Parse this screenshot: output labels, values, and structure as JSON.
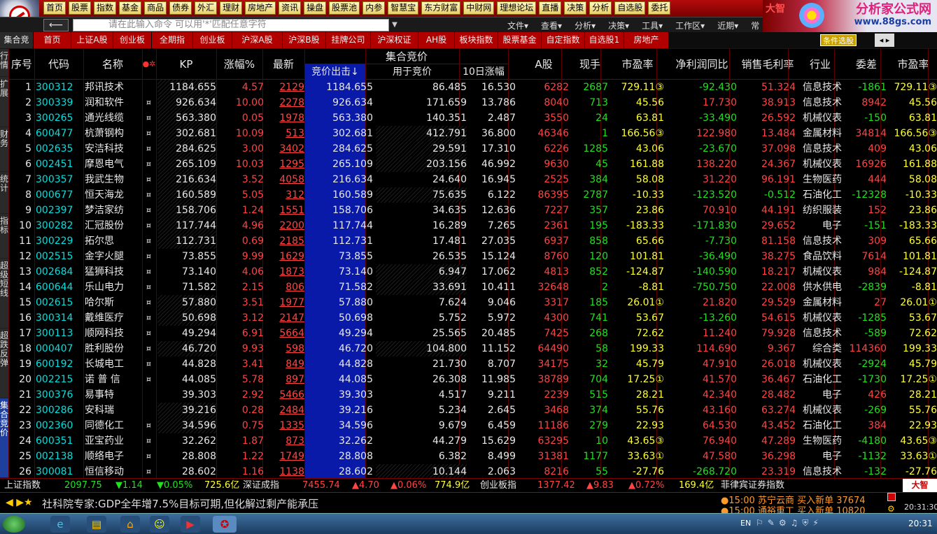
{
  "app": {
    "menu": [
      "首页",
      "股票",
      "指数",
      "基金",
      "商品",
      "债券",
      "外汇",
      "理财",
      "房地产",
      "资讯",
      "操盘",
      "股票池",
      "内参",
      "智慧宝",
      "东方财富",
      "中财网",
      "理想论坛",
      "直播",
      "决策",
      "分析",
      "自选股",
      "委托"
    ],
    "brand_left": "大智",
    "brand_title": "分析家公式网",
    "brand_url": "www.88gs.com"
  },
  "cmdbar": {
    "back": "⟵",
    "placeholder": "请在此输入命令    可以用'*'匹配任意字符"
  },
  "rmenu": [
    "文件▾",
    "查看▾",
    "分析▾",
    "决策▾",
    "工具▾",
    "工作区▾",
    "近期▾",
    "常"
  ],
  "tabs": [
    "集合竞价",
    "首页",
    "上证A股",
    "创业板",
    "全期指",
    "创业板",
    "沪深A股",
    "沪深B股",
    "挂牌公司",
    "沪深权证",
    "AH股",
    "板块指数",
    "股票基金",
    "自定指数",
    "自选股1",
    "房地产"
  ],
  "tab_search": "条件选股",
  "tab_arrows": "◂ ▸",
  "lefttabs": [
    "行情",
    "扩展",
    "财务",
    "统计",
    "指标",
    "超级短线",
    "超跌反弹",
    "集合竞价"
  ],
  "headers": {
    "seq": "序号",
    "code": "代码",
    "name": "名称",
    "dots": "●✲",
    "kp": "KP",
    "chg": "涨幅%",
    "last": "最新",
    "group": "集合竞价",
    "bid": "竞价出击↓",
    "used": "用于竞价",
    "d10": "10日涨幅",
    "ashare": "A股",
    "hand": "现手",
    "pe": "市盈率",
    "np": "净利润同比",
    "gm": "销售毛利率",
    "ind": "行业",
    "wc": "委差",
    "pe2": "市盈率"
  },
  "rows": [
    [
      "1",
      "300312",
      "邦讯技术",
      "",
      "1184.655",
      "4.57",
      "2129",
      "1184.655",
      "86.485",
      "16.530",
      "6282",
      "2687",
      "729.11③",
      "-92.430",
      "51.324",
      "信息技术",
      "-1861",
      "729.11③"
    ],
    [
      "2",
      "300339",
      "润和软件",
      "¤",
      "926.634",
      "10.00",
      "2278",
      "926.634",
      "171.659",
      "13.786",
      "8040",
      "713",
      "45.56",
      "17.730",
      "38.913",
      "信息技术",
      "8942",
      "45.56"
    ],
    [
      "3",
      "300265",
      "通光线缆",
      "¤",
      "563.380",
      "0.05",
      "1978",
      "563.380",
      "140.351",
      "2.487",
      "3550",
      "24",
      "63.81",
      "-33.490",
      "26.592",
      "机械仪表",
      "-150",
      "63.81"
    ],
    [
      "4",
      "600477",
      "杭萧钢构",
      "¤",
      "302.681",
      "10.09",
      "513",
      "302.681",
      "412.791",
      "36.800",
      "46346",
      "1",
      "166.56③",
      "122.980",
      "13.484",
      "金属材料",
      "34814",
      "166.56③"
    ],
    [
      "5",
      "002635",
      "安洁科技",
      "¤",
      "284.625",
      "3.00",
      "3402",
      "284.625",
      "29.591",
      "17.310",
      "6226",
      "1285",
      "43.06",
      "-23.670",
      "37.098",
      "信息技术",
      "409",
      "43.06"
    ],
    [
      "6",
      "002451",
      "摩恩电气",
      "¤",
      "265.109",
      "10.03",
      "1295",
      "265.109",
      "203.156",
      "46.992",
      "9630",
      "45",
      "161.88",
      "138.220",
      "24.367",
      "机械仪表",
      "16926",
      "161.88"
    ],
    [
      "7",
      "300357",
      "我武生物",
      "¤",
      "216.634",
      "3.52",
      "4058",
      "216.634",
      "24.640",
      "16.945",
      "2525",
      "384",
      "58.08",
      "31.220",
      "96.191",
      "生物医药",
      "444",
      "58.08"
    ],
    [
      "8",
      "000677",
      "恒天海龙",
      "¤",
      "160.589",
      "5.05",
      "312",
      "160.589",
      "75.635",
      "6.122",
      "86395",
      "2787",
      "-10.33",
      "-123.520",
      "-0.512",
      "石油化工",
      "-12328",
      "-10.33"
    ],
    [
      "9",
      "002397",
      "梦洁家纺",
      "¤",
      "158.706",
      "1.24",
      "1551",
      "158.706",
      "34.635",
      "12.636",
      "7227",
      "357",
      "23.86",
      "70.910",
      "44.191",
      "纺织服装",
      "152",
      "23.86"
    ],
    [
      "10",
      "300282",
      "汇冠股份",
      "¤",
      "117.744",
      "4.96",
      "2200",
      "117.744",
      "16.289",
      "7.265",
      "2361",
      "195",
      "-183.33",
      "-171.830",
      "29.652",
      "电子",
      "-151",
      "-183.33"
    ],
    [
      "11",
      "300229",
      "拓尔思",
      "¤",
      "112.731",
      "0.69",
      "2185",
      "112.731",
      "17.481",
      "27.035",
      "6937",
      "858",
      "65.66",
      "-7.730",
      "81.158",
      "信息技术",
      "309",
      "65.66"
    ],
    [
      "12",
      "002515",
      "金字火腿",
      "¤",
      "73.855",
      "9.99",
      "1629",
      "73.855",
      "26.535",
      "15.124",
      "8760",
      "120",
      "101.81",
      "-36.490",
      "38.275",
      "食品饮料",
      "7614",
      "101.81"
    ],
    [
      "13",
      "002684",
      "猛狮科技",
      "¤",
      "73.140",
      "4.06",
      "1873",
      "73.140",
      "6.947",
      "17.062",
      "4813",
      "852",
      "-124.87",
      "-140.590",
      "18.217",
      "机械仪表",
      "984",
      "-124.87"
    ],
    [
      "14",
      "600644",
      "乐山电力",
      "¤",
      "71.582",
      "2.15",
      "806",
      "71.582",
      "33.691",
      "10.411",
      "32648",
      "2",
      "-8.81",
      "-750.750",
      "22.008",
      "供水供电",
      "-2839",
      "-8.81"
    ],
    [
      "15",
      "002615",
      "哈尔斯",
      "¤",
      "57.880",
      "3.51",
      "1977",
      "57.880",
      "7.624",
      "9.046",
      "3317",
      "185",
      "26.01①",
      "21.820",
      "29.529",
      "金属材料",
      "27",
      "26.01①"
    ],
    [
      "16",
      "300314",
      "戴维医疗",
      "¤",
      "50.698",
      "3.12",
      "2147",
      "50.698",
      "5.752",
      "5.972",
      "4300",
      "741",
      "53.67",
      "-13.260",
      "54.615",
      "机械仪表",
      "-1285",
      "53.67"
    ],
    [
      "17",
      "300113",
      "顺网科技",
      "¤",
      "49.294",
      "6.91",
      "5664",
      "49.294",
      "25.565",
      "20.485",
      "7425",
      "268",
      "72.62",
      "11.240",
      "79.928",
      "信息技术",
      "-589",
      "72.62"
    ],
    [
      "18",
      "000407",
      "胜利股份",
      "¤",
      "46.720",
      "9.93",
      "598",
      "46.720",
      "104.800",
      "11.152",
      "64490",
      "58",
      "199.33",
      "114.690",
      "9.367",
      "综合类",
      "114360",
      "199.33"
    ],
    [
      "19",
      "600192",
      "长城电工",
      "¤",
      "44.828",
      "3.41",
      "849",
      "44.828",
      "21.730",
      "8.707",
      "34175",
      "32",
      "45.79",
      "47.910",
      "26.018",
      "机械仪表",
      "-2924",
      "45.79"
    ],
    [
      "20",
      "002215",
      "诺 普 信",
      "¤",
      "44.085",
      "5.78",
      "897",
      "44.085",
      "26.308",
      "11.985",
      "38789",
      "704",
      "17.25①",
      "41.570",
      "36.467",
      "石油化工",
      "-1730",
      "17.25①"
    ],
    [
      "21",
      "300376",
      "易事特",
      "",
      "39.303",
      "2.92",
      "5466",
      "39.303",
      "4.517",
      "9.211",
      "2239",
      "515",
      "28.21",
      "42.340",
      "28.482",
      "电子",
      "426",
      "28.21"
    ],
    [
      "22",
      "300286",
      "安科瑞",
      "",
      "39.216",
      "0.28",
      "2484",
      "39.216",
      "5.234",
      "2.645",
      "3468",
      "374",
      "55.76",
      "43.160",
      "63.274",
      "机械仪表",
      "-269",
      "55.76"
    ],
    [
      "23",
      "002360",
      "同德化工",
      "¤",
      "34.596",
      "0.75",
      "1335",
      "34.596",
      "9.679",
      "6.459",
      "11186",
      "279",
      "22.93",
      "64.530",
      "43.452",
      "石油化工",
      "384",
      "22.93"
    ],
    [
      "24",
      "600351",
      "亚宝药业",
      "¤",
      "32.262",
      "1.87",
      "873",
      "32.262",
      "44.279",
      "15.629",
      "63295",
      "10",
      "43.65③",
      "76.940",
      "47.289",
      "生物医药",
      "-4180",
      "43.65③"
    ],
    [
      "25",
      "002138",
      "顺络电子",
      "¤",
      "28.808",
      "1.22",
      "1749",
      "28.808",
      "6.382",
      "8.499",
      "31381",
      "1177",
      "33.63①",
      "47.580",
      "36.298",
      "电子",
      "-1132",
      "33.63①"
    ],
    [
      "26",
      "300081",
      "恒信移动",
      "¤",
      "28.602",
      "1.16",
      "1138",
      "28.602",
      "10.144",
      "2.063",
      "8216",
      "55",
      "-27.76",
      "-268.720",
      "23.319",
      "信息技术",
      "-132",
      "-27.76"
    ]
  ],
  "status": {
    "i1": "上证指数",
    "i1v": "2097.75",
    "i1c": "▼1.14",
    "i1p": "▼0.05%",
    "i1a": "725.6亿",
    "i2": "深证成指",
    "i2v": "7455.74",
    "i2c": "▲4.70",
    "i2p": "▲0.06%",
    "i2a": "774.9亿",
    "i3": "创业板指",
    "i3v": "1377.42",
    "i3c": "▲9.83",
    "i3p": "▲0.72%",
    "i3a": "169.4亿",
    "i4": "菲律宾证券指数",
    "logo": "大智"
  },
  "ticker": {
    "nav": "◀ ▶★",
    "news": "社科院专家:GDP全年增7.5%目标可期,但化解过剩产能承压",
    "a1": "●15:00 苏宁云商 买入新单 37674",
    "a2": "●15:00 通裕重工 买入新单 10820",
    "time2": "20:31:30"
  },
  "taskbar": {
    "tray": "EN",
    "clock": "20:31"
  }
}
